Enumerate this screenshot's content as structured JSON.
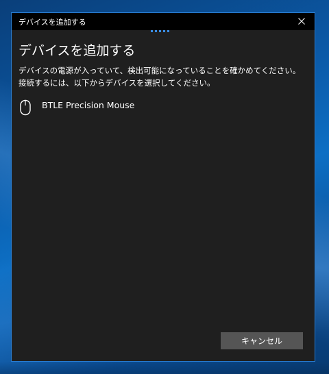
{
  "window": {
    "title": "デバイスを追加する"
  },
  "main": {
    "heading": "デバイスを追加する",
    "description": "デバイスの電源が入っていて、検出可能になっていることを確かめてください。接続するには、以下からデバイスを選択してください。",
    "devices": [
      {
        "name": "BTLE Precision Mouse",
        "icon": "mouse-icon"
      }
    ]
  },
  "footer": {
    "cancel_label": "キャンセル"
  },
  "colors": {
    "dialog_background": "#1f1f1f",
    "titlebar_background": "#000000",
    "accent": "#3a8ee6",
    "button_background": "#555555"
  }
}
